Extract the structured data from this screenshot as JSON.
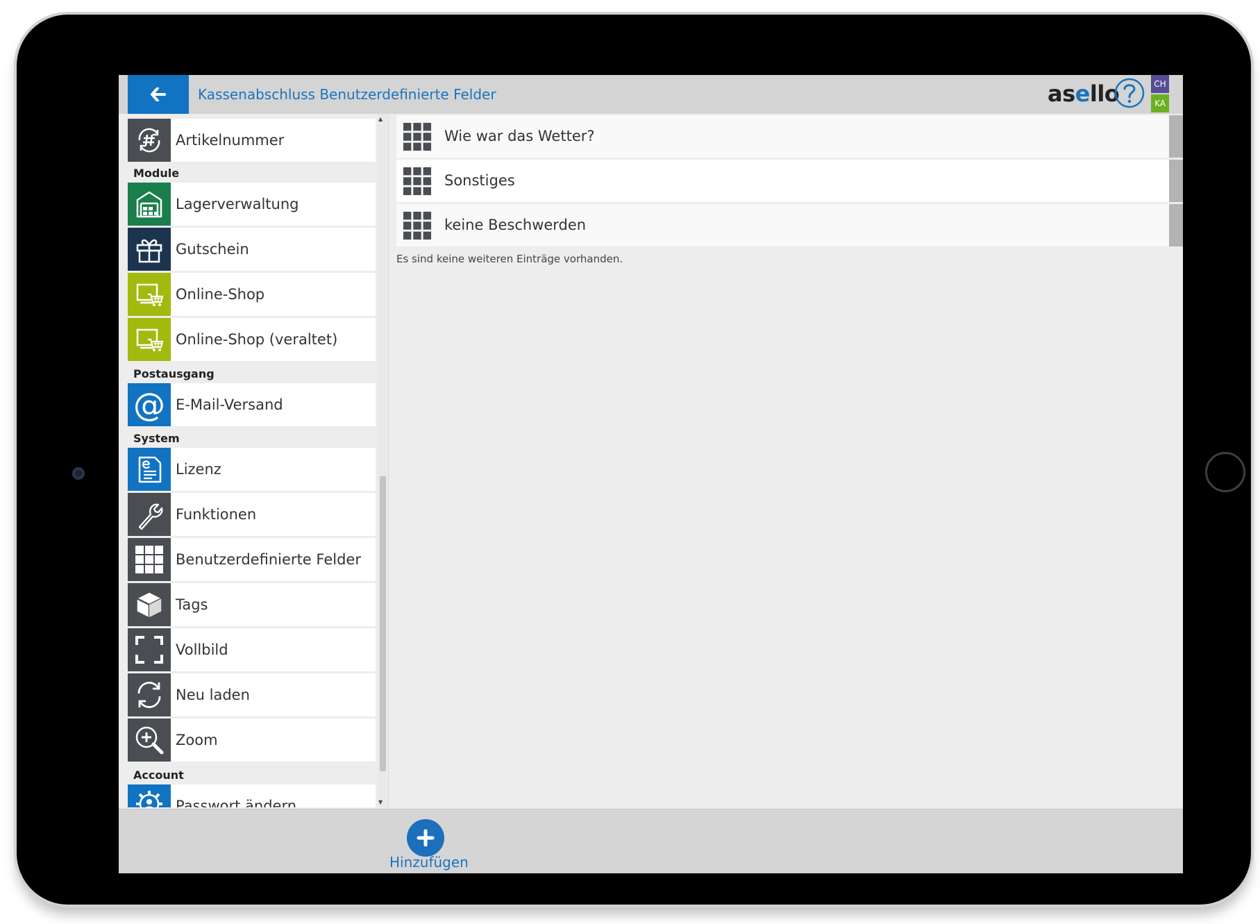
{
  "header": {
    "title": "Kassenabschluss Benutzerdefinierte Felder",
    "logo_prefix": "as",
    "logo_accent": "e",
    "logo_suffix": "llo",
    "badge_top": "CH",
    "badge_bottom": "KA"
  },
  "sidebar": {
    "sections": {
      "module": "Module",
      "postausgang": "Postausgang",
      "system": "System",
      "account": "Account"
    },
    "items": {
      "artikelnummer": "Artikelnummer",
      "lagerverwaltung": "Lagerverwaltung",
      "gutschein": "Gutschein",
      "online_shop": "Online-Shop",
      "online_shop_old": "Online-Shop (veraltet)",
      "email": "E-Mail-Versand",
      "lizenz": "Lizenz",
      "funktionen": "Funktionen",
      "benutzerdefinierte_felder": "Benutzerdefinierte Felder",
      "tags": "Tags",
      "vollbild": "Vollbild",
      "neu_laden": "Neu laden",
      "zoom": "Zoom",
      "passwort": "Passwort ändern"
    },
    "icons": {
      "artikelnummer": "hash-refresh-icon",
      "lagerverwaltung": "warehouse-icon",
      "gutschein": "gift-icon",
      "online_shop": "shopping-cart-screen-icon",
      "email": "at-sign-icon",
      "lizenz": "license-document-icon",
      "funktionen": "wrench-icon",
      "benutzerdefinierte_felder": "grid-icon",
      "tags": "cube-icon",
      "vollbild": "fullscreen-icon",
      "neu_laden": "reload-icon",
      "zoom": "zoom-in-icon",
      "passwort": "gear-user-icon"
    }
  },
  "main": {
    "rows": [
      {
        "label": "Wie war das Wetter?"
      },
      {
        "label": "Sonstiges"
      },
      {
        "label": "keine Beschwerden"
      }
    ],
    "empty_note": "Es sind keine weiteren Einträge vorhanden."
  },
  "footer": {
    "add_label": "Hinzufügen"
  },
  "colors": {
    "accent_blue": "#1173c2",
    "green": "#1a7f4b",
    "navy": "#1c3450",
    "lime": "#a2b90e",
    "gray_icon": "#4a4d52",
    "badge_purple": "#554d96",
    "badge_green": "#6ab023"
  }
}
